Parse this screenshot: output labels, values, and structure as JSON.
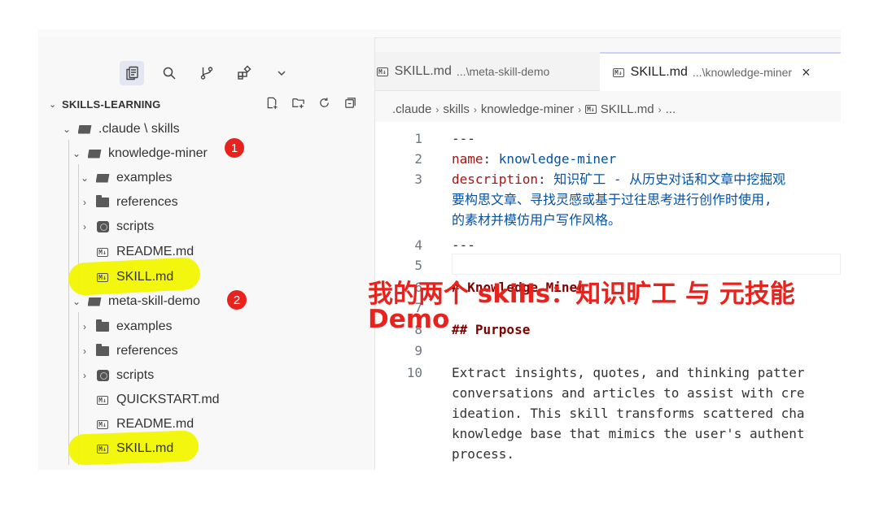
{
  "activity_bar": {
    "items": [
      {
        "icon": "files-icon",
        "active": true
      },
      {
        "icon": "search-icon"
      },
      {
        "icon": "source-control-icon"
      },
      {
        "icon": "extensions-icon"
      },
      {
        "icon": "chevron-down-icon"
      }
    ]
  },
  "explorer": {
    "title": "SKILLS-LEARNING",
    "actions": [
      "new-file-icon",
      "new-folder-icon",
      "refresh-icon",
      "collapse-all-icon"
    ]
  },
  "tree": {
    "claude_skills": ".claude \\ skills",
    "knowledge_miner": "knowledge-miner",
    "km_examples": "examples",
    "km_references": "references",
    "km_scripts": "scripts",
    "km_readme": "README.md",
    "km_skill": "SKILL.md",
    "meta_skill_demo": "meta-skill-demo",
    "msd_examples": "examples",
    "msd_references": "references",
    "msd_scripts": "scripts",
    "msd_quickstart": "QUICKSTART.md",
    "msd_readme": "README.md",
    "msd_skill": "SKILL.md"
  },
  "badges": {
    "one": "1",
    "two": "2"
  },
  "tabs": [
    {
      "label": "SKILL.md",
      "path": "...\\meta-skill-demo",
      "active": false
    },
    {
      "label": "SKILL.md",
      "path": "...\\knowledge-miner",
      "active": true,
      "close": "×"
    }
  ],
  "breadcrumb": [
    ".claude",
    "skills",
    "knowledge-miner",
    "SKILL.md",
    "..."
  ],
  "editor": {
    "line_numbers": [
      "1",
      "2",
      "3",
      "4",
      "5",
      "6",
      "7",
      "8",
      "9",
      "10"
    ],
    "l1": "---",
    "l2_key": "name",
    "l2_val": "knowledge-miner",
    "l3_key": "description",
    "l3_val": "知识矿工 - 从历史对话和文章中挖掘观",
    "l3_wrap1": "要构思文章、寻找灵感或基于过往思考进行创作时使用,",
    "l3_wrap2": "的素材并模仿用户写作风格。",
    "l4": "---",
    "l6": "# Knowledge Miner",
    "l8": "## Purpose",
    "l10_1": "Extract insights, quotes, and thinking patter",
    "l10_2": "conversations and articles to assist with cre",
    "l10_3": "ideation. This skill transforms scattered cha",
    "l10_4": "knowledge base that mimics the user's authent",
    "l10_5": "process."
  },
  "overlay": {
    "line1": "我的两个 skills：知识旷工 与 元技能",
    "line2": "Demo"
  },
  "colors": {
    "accent_red": "#e8231d",
    "highlight_yellow": "#f2f500"
  }
}
